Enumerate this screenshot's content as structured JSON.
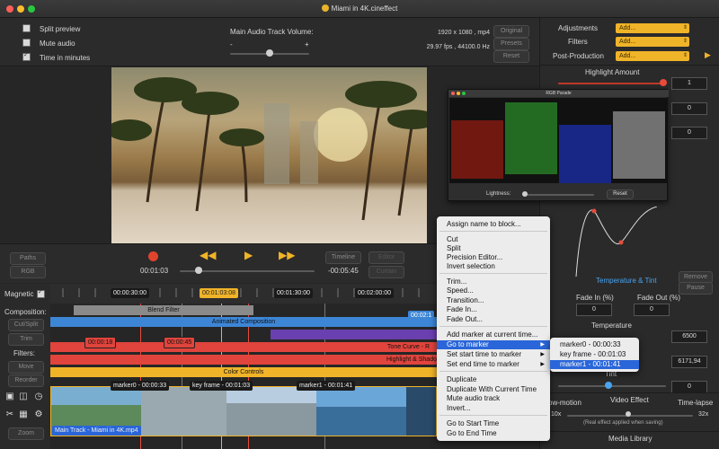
{
  "window": {
    "title": "Miami in 4K.cineffect"
  },
  "options": {
    "split_preview": "Split preview",
    "mute_audio": "Mute audio",
    "time_in_minutes": "Time in minutes"
  },
  "audio": {
    "label": "Main Audio Track Volume:",
    "minus": "-",
    "plus": "+",
    "volume": 0.5
  },
  "video_info": {
    "resolution": "1920 x 1080 , mp4",
    "fps": "29.97 fps , 44100.0 Hz"
  },
  "buttons": {
    "original": "Original",
    "presets": "Presets",
    "reset": "Reset",
    "paths": "Paths",
    "rgb": "RGB",
    "timeline": "Timeline",
    "editor": "Editor",
    "cut_split": "Cut/Split",
    "trim": "Trim",
    "move": "Move",
    "reorder": "Reorder",
    "zoom": "Zoom",
    "curtain": "Curtain",
    "remove": "Remove",
    "pause": "Pause"
  },
  "right_panel": {
    "adjustments_label": "Adjustments",
    "filters_label": "Filters",
    "post_label": "Post-Production",
    "add": "Add...",
    "highlight_label": "Highlight Amount",
    "values": [
      "1",
      "0",
      "0"
    ],
    "temp_tint_label": "Temperature & Tint",
    "fade_in_label": "Fade In (%)",
    "fade_out_label": "Fade Out (%)",
    "fade_in_value": "0",
    "fade_out_value": "0",
    "temperature_label": "Temperature",
    "temperature_value": "6500",
    "value_6171": "6171,94",
    "tint_label": "Tint",
    "tint_value": "0",
    "slowmo_label": "ow-motion",
    "video_effect_label": "Video Effect",
    "timelapse_label": "Time-lapse",
    "x10": "10x",
    "x32": "32x",
    "effect_note": "(Real effect applied when saving)",
    "media_library": "Media Library"
  },
  "rgb_parade": {
    "title": "RGB Parade",
    "lightness_label": "Lightness:",
    "reset_label": "Reset"
  },
  "transport": {
    "current": "00:01:03",
    "remaining": "-00:05:45",
    "progress": 0.14
  },
  "timeline": {
    "magnetic_label": "Magnetic",
    "composition_label": "Composition:",
    "filters_label": "Filters:",
    "ruler": [
      "00:00:30:00",
      "00:01:03:08",
      "00:01:30:00",
      "00:02:00:00"
    ],
    "chip_right": "00:02:1",
    "tracks": {
      "blend_filter": "Blend Filter",
      "animated_composition": "Animated Composition",
      "tone_curve": "Tone Curve - R",
      "highlight_shadows": "Highlight & Shado",
      "color_controls": "Color Controls"
    },
    "time_chips": [
      "00:00:18",
      "00:00:45"
    ],
    "markers": [
      "marker0 - 00:00:33",
      "key frame - 00:01:03",
      "marker1 - 00:01:41"
    ],
    "main_track": "Main Track - Miami in 4K.mp4"
  },
  "context_menu": {
    "assign_name": "Assign name to block...",
    "cut": "Cut",
    "split": "Split",
    "precision_editor": "Precision Editor...",
    "invert_selection": "Invert selection",
    "trim": "Trim...",
    "speed": "Speed...",
    "transition": "Transition...",
    "fade_in": "Fade In...",
    "fade_out": "Fade Out...",
    "add_marker": "Add marker at current time...",
    "go_to_marker": "Go to marker",
    "set_start": "Set start time to marker",
    "set_end": "Set end time to marker",
    "duplicate": "Duplicate",
    "duplicate_current": "Duplicate With Current Time",
    "mute_audio_track": "Mute audio track",
    "invert": "Invert...",
    "go_start": "Go to Start Time",
    "go_end": "Go to End Time"
  },
  "submenu": {
    "items": [
      "marker0 - 00:00:33",
      "key frame - 00:01:03",
      "marker1 - 00:01:41"
    ]
  },
  "colors": {
    "accent": "#f0b429",
    "highlight": "#2a66d9",
    "play": "#f0b429",
    "record": "#e0442c"
  },
  "icons": [
    "record-icon",
    "rewind-icon",
    "play-icon",
    "fast-forward-icon",
    "scissors-icon",
    "film-icon",
    "camera-icon",
    "stopwatch-icon",
    "gear-icon",
    "arrow-right-icon"
  ]
}
